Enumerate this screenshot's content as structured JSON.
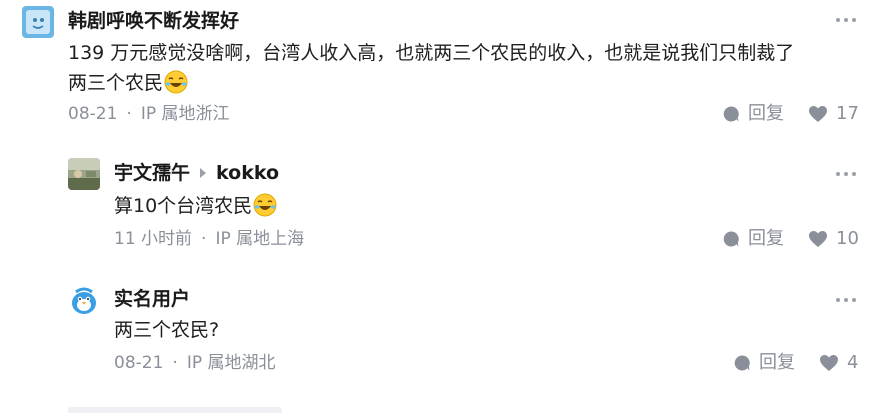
{
  "comments": [
    {
      "author": "韩剧呼唤不断发挥好",
      "content_lines": [
        "139 万元感觉没啥啊，台湾人收入高，也就两三个农民的收入，也就是说我们只制裁了",
        "两三个农民"
      ],
      "emoji": "laughing-crying-emoji",
      "time": "08-21",
      "separator": "·",
      "location": "IP 属地浙江",
      "reply_label": "回复",
      "like_count": "17",
      "avatar_icon": "default-avatar-icon",
      "avatar_color": "#6cb6e6"
    },
    {
      "author": "宇文孺午",
      "reply_to": "kokko",
      "content_lines": [
        "算10个台湾农民"
      ],
      "emoji": "laughing-crying-emoji",
      "time": "11 小时前",
      "separator": "·",
      "location": "IP 属地上海",
      "reply_label": "回复",
      "like_count": "10",
      "avatar_icon": "photo-avatar-icon",
      "avatar_color": "#7d8a6a"
    },
    {
      "author": "实名用户",
      "content_lines": [
        "两三个农民?"
      ],
      "time": "08-21",
      "separator": "·",
      "location": "IP 属地湖北",
      "reply_label": "回复",
      "like_count": "4",
      "avatar_icon": "bird-avatar-icon",
      "avatar_color": "#3a9ee4"
    }
  ],
  "colors": {
    "text_primary": "#1f1f1f",
    "text_secondary": "#8a8f99",
    "icon": "#9aa0a9"
  }
}
